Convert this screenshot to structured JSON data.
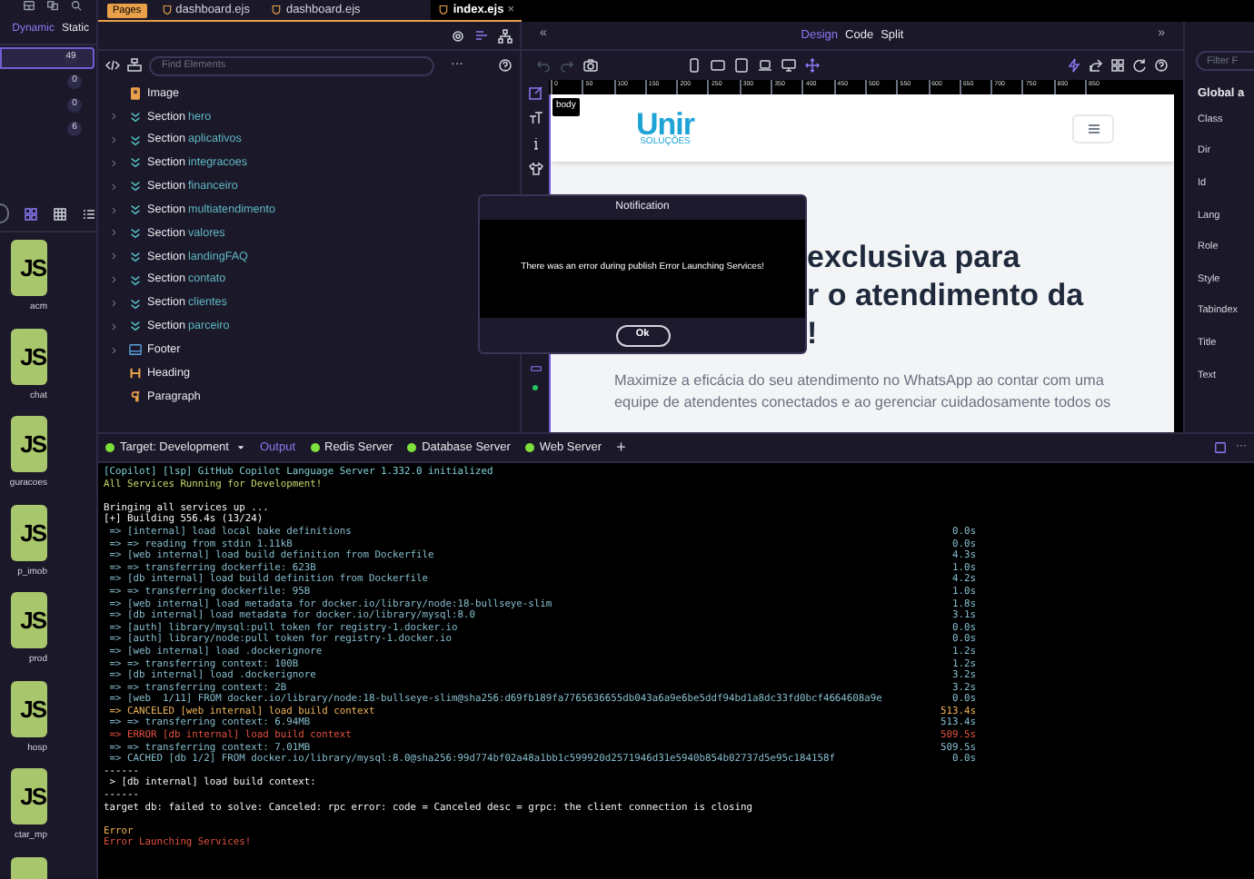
{
  "sidebar": {
    "tabs": [
      {
        "label": "Dynamic",
        "selected": true
      },
      {
        "label": "Static",
        "selected": false
      }
    ],
    "counts": [
      {
        "count": "49",
        "selected": true
      },
      {
        "count": "0",
        "selected": false
      },
      {
        "count": "0",
        "selected": false
      },
      {
        "count": "6",
        "selected": false
      }
    ],
    "views": [
      {
        "kind": "grid",
        "selected": true
      },
      {
        "kind": "table",
        "selected": false
      },
      {
        "kind": "list",
        "selected": false
      }
    ],
    "files": [
      {
        "badge": "JS",
        "label": "acm"
      },
      {
        "badge": "JS",
        "label": "chat"
      },
      {
        "badge": "JS",
        "label": "guracoes"
      },
      {
        "badge": "JS",
        "label": "p_imob"
      },
      {
        "badge": "JS",
        "label": "prod"
      },
      {
        "badge": "JS",
        "label": "hosp"
      },
      {
        "badge": "JS",
        "label": "ctar_mp"
      },
      {
        "kind": "partial"
      }
    ]
  },
  "editor_tabs": {
    "pages_badge": "Pages",
    "tabs": [
      {
        "label": "dashboard.ejs",
        "selected": false,
        "closable": false
      },
      {
        "label": "dashboard.ejs",
        "selected": false,
        "closable": false
      },
      {
        "label": "index.ejs",
        "selected": true,
        "closable": true
      }
    ],
    "close": "×"
  },
  "elements": {
    "search": {
      "placeholder": "Find Elements"
    },
    "more": "···",
    "tree": [
      {
        "kind": "image",
        "label": "Image",
        "expandable": false
      },
      {
        "kind": "section",
        "label": "Section",
        "name": "hero",
        "expandable": true
      },
      {
        "kind": "section",
        "label": "Section",
        "name": "aplicativos",
        "expandable": true
      },
      {
        "kind": "section",
        "label": "Section",
        "name": "integracoes",
        "expandable": true
      },
      {
        "kind": "section",
        "label": "Section",
        "name": "financeiro",
        "expandable": true
      },
      {
        "kind": "section",
        "label": "Section",
        "name": "multiatendimento",
        "expandable": true
      },
      {
        "kind": "section",
        "label": "Section",
        "name": "valores",
        "expandable": true
      },
      {
        "kind": "section",
        "label": "Section",
        "name": "landingFAQ",
        "expandable": true
      },
      {
        "kind": "section",
        "label": "Section",
        "name": "contato",
        "expandable": true
      },
      {
        "kind": "section",
        "label": "Section",
        "name": "clientes",
        "expandable": true
      },
      {
        "kind": "section",
        "label": "Section",
        "name": "parceiro",
        "expandable": true
      },
      {
        "kind": "footer",
        "label": "Footer",
        "expandable": true
      },
      {
        "kind": "heading",
        "label": "Heading",
        "expandable": false
      },
      {
        "kind": "paragraph",
        "label": "Paragraph",
        "expandable": false
      }
    ]
  },
  "design": {
    "collapse_left": "«",
    "collapse_right": "»",
    "modes": [
      {
        "label": "Design",
        "selected": true
      },
      {
        "label": "Code",
        "selected": false
      },
      {
        "label": "Split",
        "selected": false
      }
    ],
    "ruler": [
      "0",
      "50",
      "100",
      "150",
      "200",
      "250",
      "300",
      "350",
      "400",
      "450",
      "500",
      "550",
      "600",
      "650",
      "700",
      "750",
      "800",
      "850"
    ],
    "canvas": {
      "tag": "body",
      "logo": "Unir",
      "logo_sub": "SOLUÇÕES",
      "heading_lines": [
        "exclusiva para",
        "r o atendimento da",
        "!"
      ],
      "paragraph_lines": [
        "Maximize a eficácia do seu atendimento no WhatsApp ao contar com uma",
        "equipe de atendentes conectados e ao gerenciar cuidadosamente todos os"
      ]
    }
  },
  "properties": {
    "filter": {
      "placeholder": "Filter F"
    },
    "title": "Global a",
    "attributes": [
      "Class",
      "Dir",
      "Id",
      "Lang",
      "Role",
      "Style",
      "Tabindex",
      "Title",
      "Text"
    ]
  },
  "notification": {
    "title": "Notification",
    "message": "There was an error during publish Error Launching Services!",
    "button": "Ok"
  },
  "terminal": {
    "tabs": [
      {
        "label": "Target: Development",
        "kind": "target",
        "selected": false
      },
      {
        "label": "Output",
        "kind": "plain",
        "selected": true
      },
      {
        "label": "Redis Server",
        "kind": "server",
        "selected": false
      },
      {
        "label": "Database Server",
        "kind": "server",
        "selected": false
      },
      {
        "label": "Web Server",
        "kind": "server",
        "selected": false
      }
    ],
    "add": "+",
    "more": "···",
    "lines": [
      {
        "kind": "copilot",
        "text": "[Copilot] [lsp] GitHub Copilot Language Server 1.332.0 initialized"
      },
      {
        "kind": "success",
        "text": "All Services Running for Development!"
      },
      {
        "kind": "blank"
      },
      {
        "kind": "plain",
        "text": "Bringing all services up ..."
      },
      {
        "kind": "plain",
        "text": "[+] Building 556.4s (13/24)"
      },
      {
        "kind": "build",
        "text": " => [internal] load local bake definitions",
        "time": "0.0s"
      },
      {
        "kind": "build",
        "text": " => => reading from stdin 1.11kB",
        "time": "0.0s"
      },
      {
        "kind": "build",
        "text": " => [web internal] load build definition from Dockerfile",
        "time": "4.3s"
      },
      {
        "kind": "build",
        "text": " => => transferring dockerfile: 623B",
        "time": "1.0s"
      },
      {
        "kind": "build",
        "text": " => [db internal] load build definition from Dockerfile",
        "time": "4.2s"
      },
      {
        "kind": "build",
        "text": " => => transferring dockerfile: 95B",
        "time": "1.0s"
      },
      {
        "kind": "build",
        "text": " => [web internal] load metadata for docker.io/library/node:18-bullseye-slim",
        "time": "1.8s"
      },
      {
        "kind": "build",
        "text": " => [db internal] load metadata for docker.io/library/mysql:8.0",
        "time": "3.1s"
      },
      {
        "kind": "build",
        "text": " => [auth] library/mysql:pull token for registry-1.docker.io",
        "time": "0.0s"
      },
      {
        "kind": "build",
        "text": " => [auth] library/node:pull token for registry-1.docker.io",
        "time": "0.0s"
      },
      {
        "kind": "build",
        "text": " => [web internal] load .dockerignore",
        "time": "1.2s"
      },
      {
        "kind": "build",
        "text": " => => transferring context: 100B",
        "time": "1.2s"
      },
      {
        "kind": "build",
        "text": " => [db internal] load .dockerignore",
        "time": "3.2s"
      },
      {
        "kind": "build",
        "text": " => => transferring context: 2B",
        "time": "3.2s"
      },
      {
        "kind": "build",
        "text": " => [web  1/11] FROM docker.io/library/node:18-bullseye-slim@sha256:d69fb189fa7765636655db043a6a9e6be5ddf94bd1a8dc33fd0bcf4664608a9e",
        "time": "0.0s"
      },
      {
        "kind": "canceled",
        "text": " => CANCELED [web internal] load build context",
        "time": "513.4s"
      },
      {
        "kind": "build",
        "text": " => => transferring context: 6.94MB",
        "time": "513.4s"
      },
      {
        "kind": "error",
        "text": " => ERROR [db internal] load build context",
        "time": "509.5s"
      },
      {
        "kind": "build",
        "text": " => => transferring context: 7.01MB",
        "time": "509.5s"
      },
      {
        "kind": "build",
        "text": " => CACHED [db 1/2] FROM docker.io/library/mysql:8.0@sha256:99d774bf02a48a1bb1c599920d2571946d31e5940b854b02737d5e95c184158f",
        "time": "0.0s"
      },
      {
        "kind": "plain",
        "text": "------"
      },
      {
        "kind": "plain",
        "text": " > [db internal] load build context:"
      },
      {
        "kind": "plain",
        "text": "------"
      },
      {
        "kind": "plain",
        "text": "target db: failed to solve: Canceled: rpc error: code = Canceled desc = grpc: the client connection is closing"
      },
      {
        "kind": "blank"
      },
      {
        "kind": "canceled",
        "text": "Error"
      },
      {
        "kind": "error",
        "text": "Error Launching Services!"
      }
    ]
  }
}
